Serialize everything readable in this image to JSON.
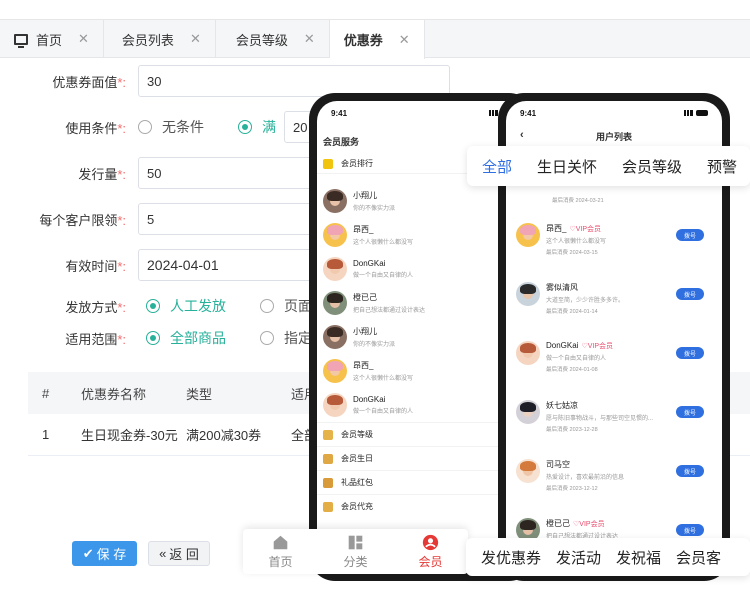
{
  "tabs": [
    {
      "label": "首页",
      "active": false
    },
    {
      "label": "会员列表",
      "active": false
    },
    {
      "label": "会员等级",
      "active": false
    },
    {
      "label": "优惠券",
      "active": true
    }
  ],
  "form": {
    "face_value": {
      "label": "优惠券面值",
      "value": "30"
    },
    "condition": {
      "label": "使用条件",
      "opt_none": "无条件",
      "opt_full": "满",
      "value": "20"
    },
    "quantity": {
      "label": "发行量",
      "value": "50"
    },
    "per_customer": {
      "label": "每个客户限领",
      "value": "5"
    },
    "valid_time": {
      "label": "有效时间",
      "value": "2024-04-01"
    },
    "issue_method": {
      "label": "发放方式",
      "opt_manual": "人工发放",
      "opt_page": "页面"
    },
    "scope": {
      "label": "适用范围",
      "opt_all": "全部商品",
      "opt_spec": "指定"
    }
  },
  "table": {
    "headers": [
      "#",
      "优惠券名称",
      "类型",
      "适用"
    ],
    "rows": [
      [
        "1",
        "生日现金券-30元",
        "满200减30券",
        "全部"
      ]
    ]
  },
  "buttons": {
    "save": "保 存",
    "back": "返 回"
  },
  "phone1": {
    "time": "9:41",
    "title": "会员服务",
    "rank_label": "会员排行",
    "members": [
      {
        "name": "小翔儿",
        "desc": "你的不像实力派"
      },
      {
        "name": "昂西_",
        "desc": "这个人很懒什么都没写"
      },
      {
        "name": "DonGKai",
        "desc": "做一个自由又自律的人"
      },
      {
        "name": "橙已己",
        "desc": "把自己想法都通过设计表达"
      },
      {
        "name": "小翔儿",
        "desc": "你的不像实力派"
      },
      {
        "name": "昂西_",
        "desc": "这个人很懒什么都没写"
      },
      {
        "name": "DonGKai",
        "desc": "做一个自由又自律的人"
      }
    ],
    "menu": [
      "会员等级",
      "会员生日",
      "礼品红包",
      "会员代充"
    ]
  },
  "phone2": {
    "time": "9:41",
    "title": "用户列表",
    "top_date": "最后消费  2024-03-21",
    "users": [
      {
        "name": "昂西_",
        "vip": "VIP会员",
        "desc": "这个人很懒什么都没写",
        "date": "最后消费  2024-03-15",
        "badge": "拨号"
      },
      {
        "name": "雾似清风",
        "vip": "",
        "desc": "大道至简，少少许胜多多许。",
        "date": "最后消费  2024-01-14",
        "badge": "拨号"
      },
      {
        "name": "DonGKai",
        "vip": "VIP会员",
        "desc": "做一个自由又自律的人",
        "date": "最后消费  2024-01-08",
        "badge": "拨号"
      },
      {
        "name": "妖七姑凉",
        "vip": "",
        "desc": "愿与陈旧事物战斗，与那些司空见惯的...",
        "date": "最后消费  2023-12-28",
        "badge": "拨号"
      },
      {
        "name": "司马空",
        "vip": "",
        "desc": "热爱设计，喜欢最前沿的信息",
        "date": "最后消费  2023-12-12",
        "badge": "拨号"
      },
      {
        "name": "橙已己",
        "vip": "VIP会员",
        "desc": "把自己想法都通过设计表达",
        "date": "",
        "badge": "拨号"
      }
    ]
  },
  "filter_tabs": [
    "全部",
    "生日关怀",
    "会员等级",
    "预警"
  ],
  "bottom_nav": [
    "首页",
    "分类",
    "会员"
  ],
  "actions": [
    "发优惠券",
    "发活动",
    "发祝福",
    "会员客"
  ]
}
